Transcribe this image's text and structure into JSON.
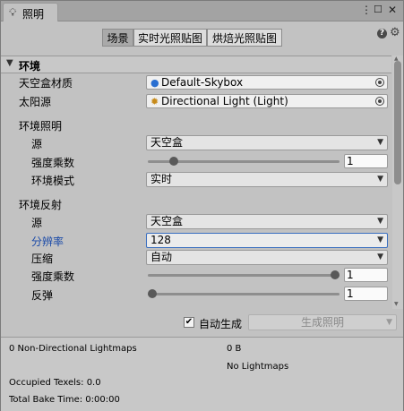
{
  "window": {
    "tab_title": "照明",
    "menu_icon": "more-vertical-icon",
    "maximize_icon": "maximize-icon",
    "close_icon": "close-icon"
  },
  "toolbar": {
    "tabs": [
      {
        "label": "场景",
        "active": true
      },
      {
        "label": "实时光照贴图",
        "active": false
      },
      {
        "label": "烘焙光照贴图",
        "active": false
      }
    ],
    "help_icon": "help-icon",
    "settings_icon": "gear-icon"
  },
  "environment": {
    "header": "环境",
    "skybox_material": {
      "label": "天空盒材质",
      "value": "Default-Skybox",
      "icon": "material-sphere-icon"
    },
    "sun_source": {
      "label": "太阳源",
      "value": "Directional Light (Light)",
      "icon": "light-icon"
    },
    "lighting": {
      "title": "环境照明",
      "source": {
        "label": "源",
        "value": "天空盒"
      },
      "intensity": {
        "label": "强度乘数",
        "value": "1",
        "level": 0.12
      },
      "mode": {
        "label": "环境模式",
        "value": "实时"
      }
    },
    "reflections": {
      "title": "环境反射",
      "source": {
        "label": "源",
        "value": "天空盒"
      },
      "resolution": {
        "label": "分辨率",
        "value": "128"
      },
      "compression": {
        "label": "压缩",
        "value": "自动"
      },
      "intensity": {
        "label": "强度乘数",
        "value": "1",
        "level": 1.0
      },
      "bounces": {
        "label": "反弹",
        "value": "1",
        "level": 0.0
      }
    }
  },
  "generate": {
    "auto_checked": true,
    "auto_label": "自动生成",
    "button_label": "生成照明"
  },
  "stats": {
    "lightmaps": "0 Non-Directional Lightmaps",
    "size": "0 B",
    "no_lightmaps": "No Lightmaps",
    "texels": "Occupied Texels: 0.0",
    "bake_time": "Total Bake Time: 0:00:00"
  },
  "colors": {
    "panel_bg": "#c2c2c2",
    "focus_accent": "#3a6fc0",
    "label_highlight": "#1a4aa8"
  }
}
